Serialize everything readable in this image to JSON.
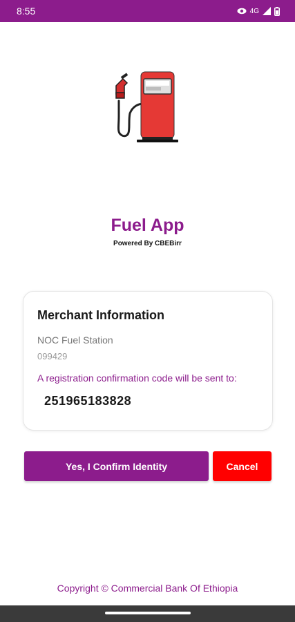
{
  "status_bar": {
    "time": "8:55",
    "network": "4G",
    "icons": [
      "eye-icon",
      "signal-icon",
      "battery-icon"
    ],
    "color": "#8c1c8c"
  },
  "app": {
    "logo_icon": "fuel-pump-icon",
    "title": "Fuel App",
    "subtitle": "Powered By CBEBirr"
  },
  "merchant_card": {
    "title": "Merchant Information",
    "merchant_name": "NOC Fuel Station",
    "merchant_id": "099429",
    "confirmation_note": "A registration confirmation code will be sent to:",
    "phone_number": "251965183828"
  },
  "actions": {
    "confirm_label": "Yes, I Confirm Identity",
    "cancel_label": "Cancel",
    "confirm_color": "#8c1c8c",
    "cancel_color": "#ff0000"
  },
  "footer": {
    "copyright": "Copyright © Commercial Bank Of Ethiopia"
  }
}
